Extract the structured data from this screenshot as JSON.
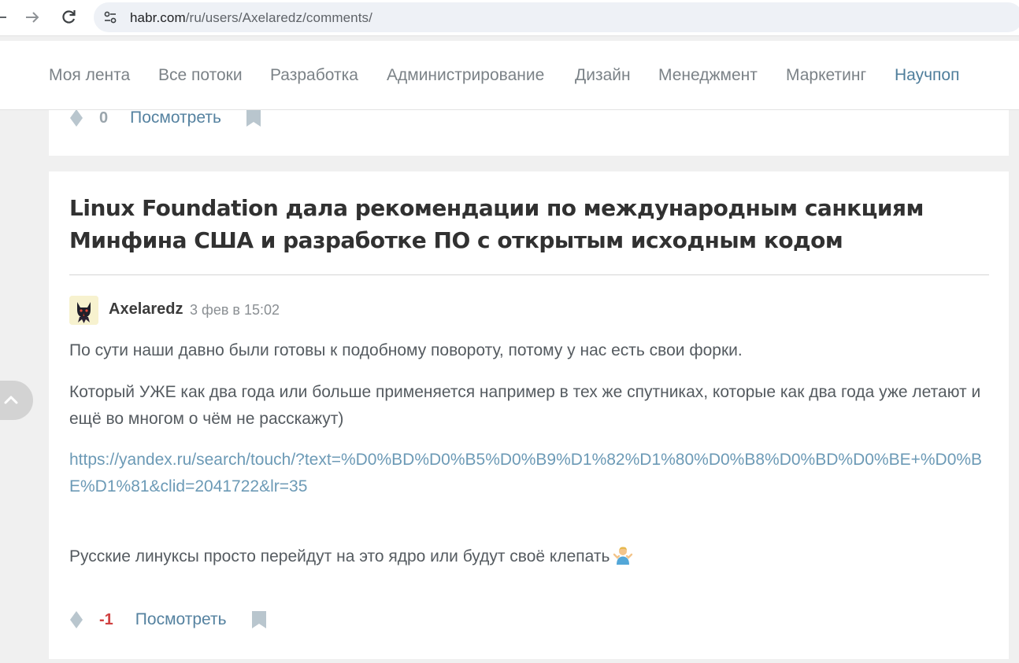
{
  "browser": {
    "url_host": "habr.com",
    "url_path": "/ru/users/Axelaredz/comments/"
  },
  "nav": {
    "items": [
      {
        "label": "Моя лента"
      },
      {
        "label": "Все потоки"
      },
      {
        "label": "Разработка"
      },
      {
        "label": "Администрирование"
      },
      {
        "label": "Дизайн"
      },
      {
        "label": "Менеджмент"
      },
      {
        "label": "Маркетинг"
      },
      {
        "label": "Научпоп",
        "active": true
      }
    ]
  },
  "prev_comment": {
    "score": "0",
    "view_label": "Посмотреть"
  },
  "comment": {
    "post_title": "Linux Foundation дала рекомендации по международным санкциям Минфина США и разработке ПО с открытым исходным кодом",
    "author": "Axelaredz",
    "date": "3 фев в 15:02",
    "paragraphs": [
      "По сути наши давно были готовы к подобному повороту, потому у нас есть свои форки.",
      "Который УЖЕ как два года или больше применяется например в тех же спутниках, которые как два года уже летают и ещё во многом о чём не расскажут)"
    ],
    "link": "https://yandex.ru/search/touch/?text=%D0%BD%D0%B5%D0%B9%D1%82%D1%80%D0%B8%D0%BD%D0%BE+%D0%BE%D1%81&clid=2041722&lr=35",
    "last_paragraph": "Русские линуксы просто перейдут на это ядро или будут своё клепать",
    "score": "-1",
    "view_label": "Посмотреть"
  },
  "icons": {
    "rating": "rating-icon",
    "bookmark": "bookmark-icon",
    "scroll_top": "chevron-up-icon",
    "emoji": "person-shrugging-emoji"
  },
  "colors": {
    "link": "#5582a0",
    "nav_active": "#4f7e9b",
    "negative": "#d04141"
  }
}
